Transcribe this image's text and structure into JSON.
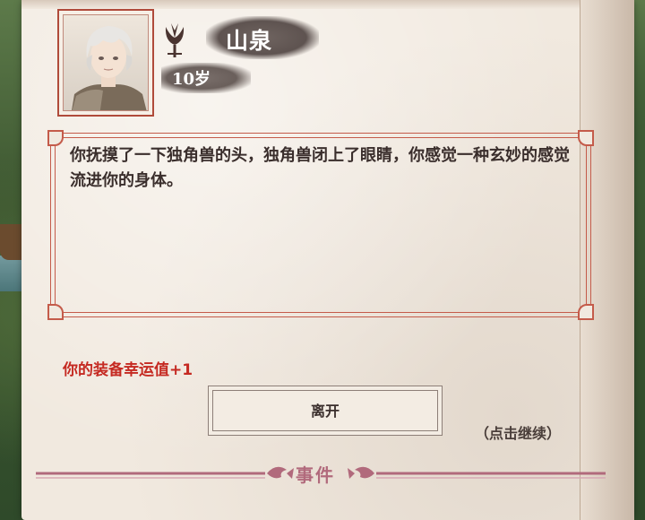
{
  "character": {
    "name": "山泉",
    "age": "10岁"
  },
  "dialog": {
    "text": "你抚摸了一下独角兽的头，独角兽闭上了眼睛，你感觉一种玄妙的感觉流进你的身体。"
  },
  "reward": {
    "text": "你的装备幸运值+1"
  },
  "actions": {
    "leave_label": "离开",
    "continue_label": "（点击继续）"
  },
  "footer": {
    "label": "事件"
  },
  "colors": {
    "paper": "#f1e9df",
    "frame_red": "#c45b4a",
    "reward_red": "#c52a22",
    "footer_pink": "#b16a7c",
    "name_plate": "#5e5350"
  },
  "icons": {
    "clan": "clan-emblem-icon",
    "footer_left": "flourish-left-icon",
    "footer_right": "flourish-right-icon"
  }
}
